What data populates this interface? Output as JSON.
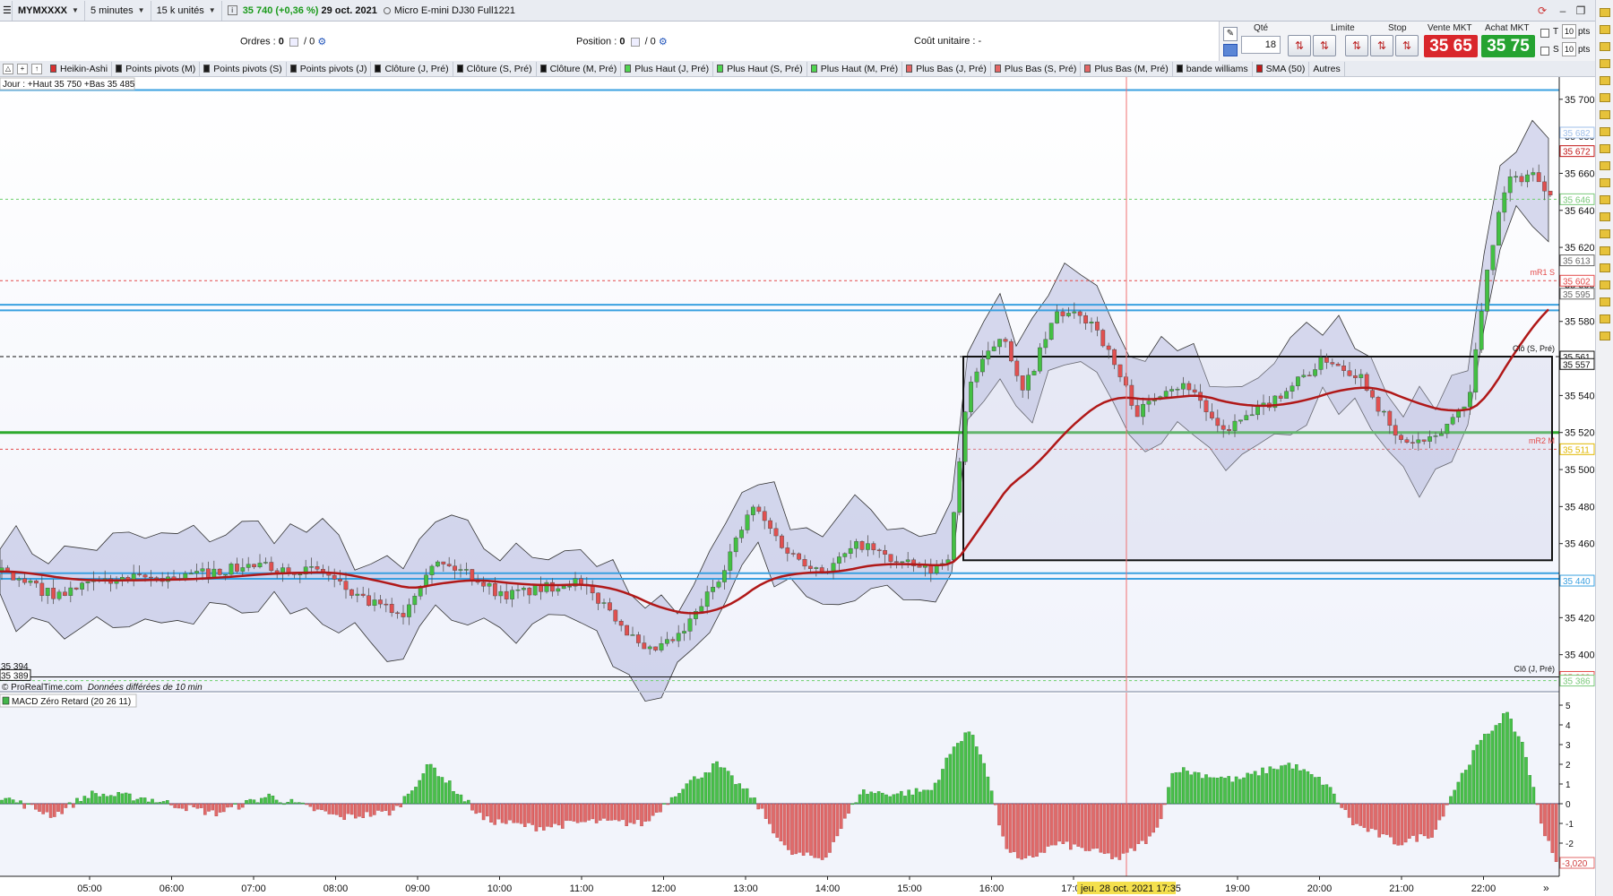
{
  "toolbar": {
    "instrument": "MYMXXXX",
    "timeframe": "5 minutes",
    "units": "15 k unités",
    "price_change": "35 740 (+0,36 %)",
    "date": "29 oct. 2021",
    "description": "Micro E-mini DJ30 Full1221"
  },
  "orderbar": {
    "orders_label": "Ordres :",
    "orders_value": "0",
    "orders_sep": "/ 0",
    "position_label": "Position :",
    "position_value": "0",
    "position_sep": "/ 0",
    "cost_label": "Coût unitaire :",
    "cost_value": "-"
  },
  "trade": {
    "qty_label": "Qté",
    "qty_value": "18",
    "limit_label": "Limite",
    "stop_label": "Stop",
    "sell_label": "Vente MKT",
    "sell_price": "35 65",
    "buy_label": "Achat MKT",
    "buy_price": "35 75",
    "t_label": "T",
    "s_label": "S",
    "pts_t": "10",
    "pts_s": "10",
    "pts_label": "pts",
    "accent_sell": "#d9262b",
    "accent_buy": "#25a331"
  },
  "legend": [
    {
      "label": "Heikin-Ashi",
      "color": "#d92f2f"
    },
    {
      "label": "Points pivots (M)",
      "color": "#1b1b1b"
    },
    {
      "label": "Points pivots (S)",
      "color": "#1b1b1b"
    },
    {
      "label": "Points pivots (J)",
      "color": "#1b1b1b"
    },
    {
      "label": "Clôture (J, Pré)",
      "color": "#111111"
    },
    {
      "label": "Clôture (S, Pré)",
      "color": "#111111"
    },
    {
      "label": "Clôture (M, Pré)",
      "color": "#111111"
    },
    {
      "label": "Plus Haut (J, Pré)",
      "color": "#4fd44f"
    },
    {
      "label": "Plus Haut (S, Pré)",
      "color": "#4fd44f"
    },
    {
      "label": "Plus Haut (M, Pré)",
      "color": "#4fd44f"
    },
    {
      "label": "Plus Bas (J, Pré)",
      "color": "#e56565"
    },
    {
      "label": "Plus Bas (S, Pré)",
      "color": "#e56565"
    },
    {
      "label": "Plus Bas (M, Pré)",
      "color": "#e56565"
    },
    {
      "label": "bande williams",
      "color": "#111111"
    },
    {
      "label": "SMA (50)",
      "color": "#c21818"
    }
  ],
  "legend_more": "Autres",
  "chart": {
    "info_label": "Jour : +Haut 35 750 +Bas 35 485",
    "watermark": "© ProRealTime.com",
    "delay_note": "Données différées de 10 min",
    "macd_label": "MACD Zéro Retard (20 26 11)",
    "crosshair_label": "jeu. 28 oct. 2021 17:35",
    "ref_labels": {
      "low_left_1": "35 394",
      "low_left_2": "35 389",
      "clo_j": "Clô (J, Pré)",
      "clo_s": "Clô (S, Pré)",
      "mr1": "mR1 S",
      "mr2": "mR2 M"
    },
    "price_ticks": [
      "35 700",
      "35 680",
      "35 660",
      "35 640",
      "35 620",
      "35 600",
      "35 580",
      "35 560",
      "35 540",
      "35 520",
      "35 500",
      "35 480",
      "35 460",
      "35 440",
      "35 420",
      "35 400"
    ],
    "price_tick_values": [
      35700,
      35680,
      35660,
      35640,
      35620,
      35600,
      35580,
      35560,
      35540,
      35520,
      35500,
      35480,
      35460,
      35440,
      35420,
      35400
    ],
    "price_tags": [
      {
        "text": "35 682",
        "value": 35682,
        "color": "#9fbfe8"
      },
      {
        "text": "35 672",
        "value": 35672,
        "color": "#c21818"
      },
      {
        "text": "35 646",
        "value": 35646,
        "color": "#79c879"
      },
      {
        "text": "35 613",
        "value": 35613,
        "color": "#666666"
      },
      {
        "text": "35 602",
        "value": 35602,
        "color": "#e34a4a"
      },
      {
        "text": "35 595",
        "value": 35595,
        "color": "#666666"
      },
      {
        "text": "35 561",
        "value": 35561,
        "color": "#111111"
      },
      {
        "text": "35 557",
        "value": 35557,
        "color": "#111111"
      },
      {
        "text": "35 511",
        "value": 35511,
        "color": "#e0b800"
      },
      {
        "text": "35 440",
        "value": 35440,
        "color": "#3aa0e0"
      },
      {
        "text": "35 388",
        "value": 35388,
        "color": "#e34a4a"
      },
      {
        "text": "35 386",
        "value": 35386,
        "color": "#79c879"
      }
    ],
    "macd_ticks": [
      "5",
      "4",
      "3",
      "2",
      "1",
      "0",
      "-1",
      "-2"
    ],
    "macd_tick_values": [
      5,
      4,
      3,
      2,
      1,
      0,
      -1,
      -2
    ],
    "macd_tag": "-3,020",
    "time_ticks": [
      "05:00",
      "06:00",
      "07:00",
      "08:00",
      "09:00",
      "10:00",
      "11:00",
      "12:00",
      "13:00",
      "14:00",
      "15:00",
      "16:00",
      "17:00",
      "19:00",
      "20:00",
      "21:00",
      "22:00"
    ],
    "time_tick_hours": [
      5,
      6,
      7,
      8,
      9,
      10,
      11,
      12,
      13,
      14,
      15,
      16,
      17,
      19,
      20,
      21,
      22
    ]
  }
}
